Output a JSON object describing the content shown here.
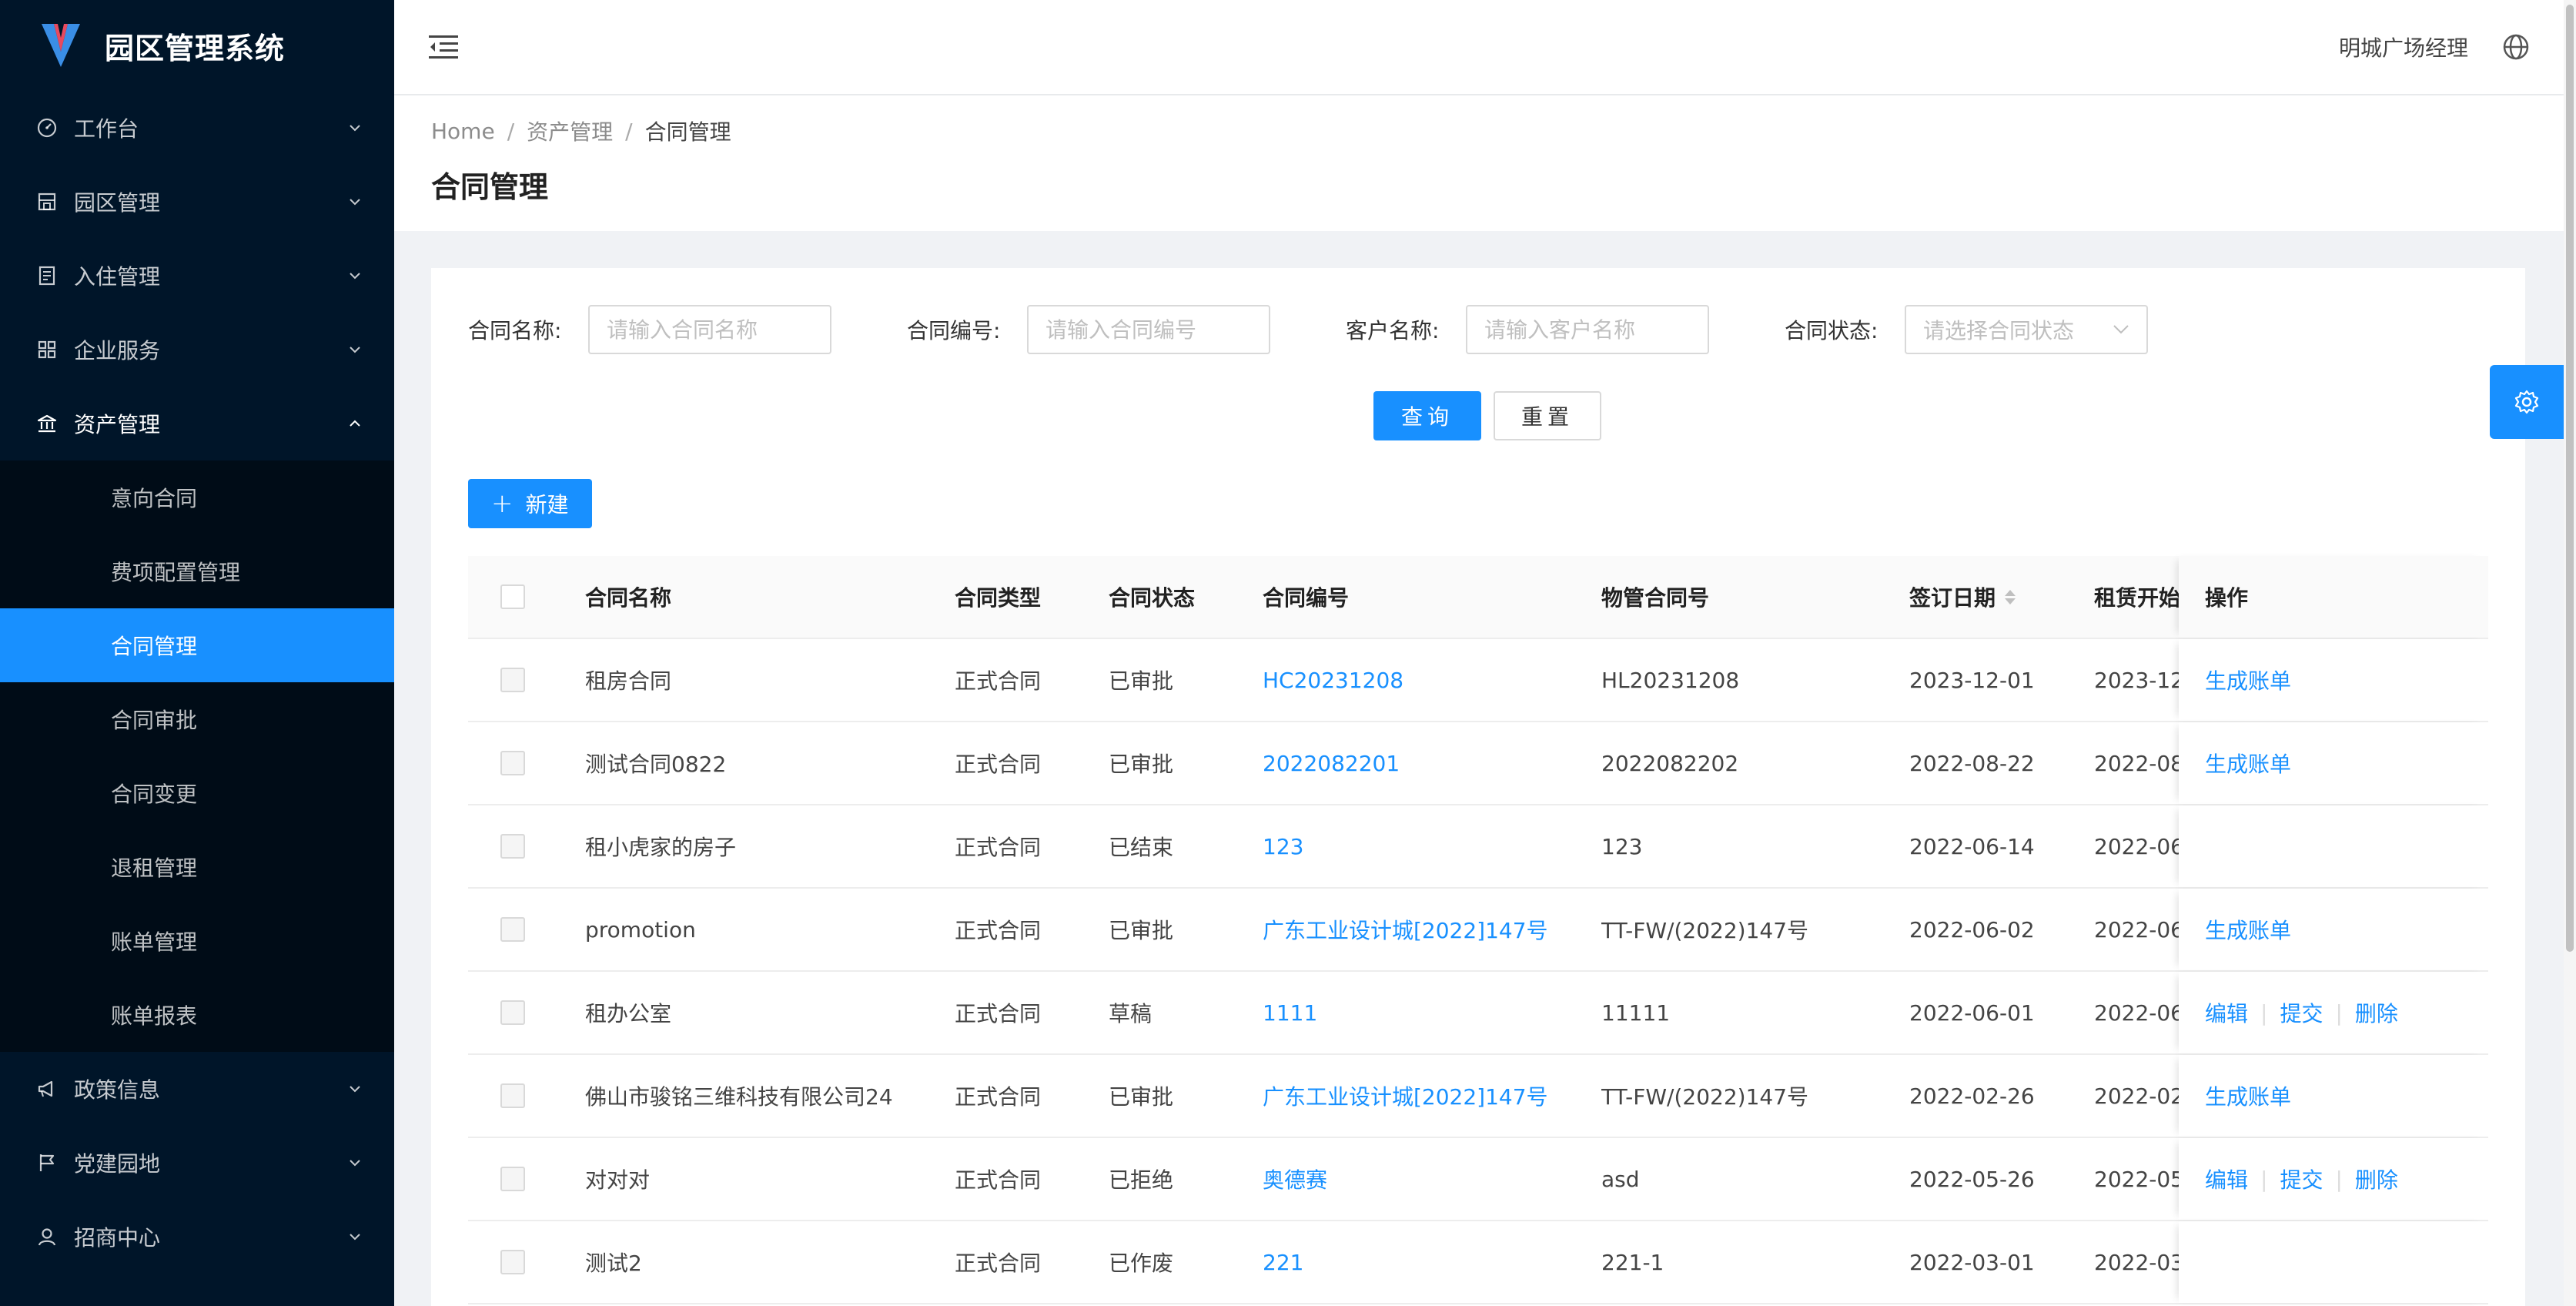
{
  "app": {
    "title": "园区管理系统"
  },
  "sidebar": {
    "items": [
      {
        "label": "工作台",
        "icon": "dashboard-icon"
      },
      {
        "label": "园区管理",
        "icon": "building-icon"
      },
      {
        "label": "入住管理",
        "icon": "document-icon"
      },
      {
        "label": "企业服务",
        "icon": "apps-icon"
      },
      {
        "label": "资产管理",
        "icon": "bank-icon",
        "open": true
      },
      {
        "label": "政策信息",
        "icon": "megaphone-icon"
      },
      {
        "label": "党建园地",
        "icon": "flag-icon"
      },
      {
        "label": "招商中心",
        "icon": "user-icon"
      }
    ],
    "submenu": [
      {
        "label": "意向合同"
      },
      {
        "label": "费项配置管理"
      },
      {
        "label": "合同管理",
        "active": true
      },
      {
        "label": "合同审批"
      },
      {
        "label": "合同变更"
      },
      {
        "label": "退租管理"
      },
      {
        "label": "账单管理"
      },
      {
        "label": "账单报表"
      }
    ]
  },
  "header": {
    "user_name": "明城广场经理"
  },
  "breadcrumb": {
    "home": "Home",
    "level1": "资产管理",
    "current": "合同管理"
  },
  "page": {
    "title": "合同管理"
  },
  "filters": {
    "contract_name": {
      "label": "合同名称:",
      "placeholder": "请输入合同名称"
    },
    "contract_no": {
      "label": "合同编号:",
      "placeholder": "请输入合同编号"
    },
    "customer_name": {
      "label": "客户名称:",
      "placeholder": "请输入客户名称"
    },
    "contract_status": {
      "label": "合同状态:",
      "placeholder": "请选择合同状态"
    }
  },
  "buttons": {
    "query": "查询",
    "reset": "重置",
    "new": "新建"
  },
  "table": {
    "columns": {
      "name": "合同名称",
      "type": "合同类型",
      "status": "合同状态",
      "no": "合同编号",
      "pm_no": "物管合同号",
      "sign_date": "签订日期",
      "start": "租赁开始",
      "action": "操作"
    },
    "rows": [
      {
        "name": "租房合同",
        "type": "正式合同",
        "status": "已审批",
        "no": "HC20231208",
        "pm_no": "HL20231208",
        "sign_date": "2023-12-01",
        "start": "2023-12",
        "actions": [
          "生成账单"
        ]
      },
      {
        "name": "测试合同0822",
        "type": "正式合同",
        "status": "已审批",
        "no": "2022082201",
        "pm_no": "2022082202",
        "sign_date": "2022-08-22",
        "start": "2022-08",
        "actions": [
          "生成账单"
        ]
      },
      {
        "name": "租小虎家的房子",
        "type": "正式合同",
        "status": "已结束",
        "no": "123",
        "pm_no": "123",
        "sign_date": "2022-06-14",
        "start": "2022-06",
        "actions": []
      },
      {
        "name": "promotion",
        "type": "正式合同",
        "status": "已审批",
        "no": "广东工业设计城[2022]147号",
        "pm_no": "TT-FW/(2022)147号",
        "sign_date": "2022-06-02",
        "start": "2022-06",
        "actions": [
          "生成账单"
        ]
      },
      {
        "name": "租办公室",
        "type": "正式合同",
        "status": "草稿",
        "no": "1111",
        "pm_no": "11111",
        "sign_date": "2022-06-01",
        "start": "2022-06",
        "actions": [
          "编辑",
          "提交",
          "删除"
        ]
      },
      {
        "name": "佛山市骏铭三维科技有限公司24",
        "type": "正式合同",
        "status": "已审批",
        "no": "广东工业设计城[2022]147号",
        "pm_no": "TT-FW/(2022)147号",
        "sign_date": "2022-02-26",
        "start": "2022-02",
        "actions": [
          "生成账单"
        ]
      },
      {
        "name": "对对对",
        "type": "正式合同",
        "status": "已拒绝",
        "no": "奥德赛",
        "pm_no": "asd",
        "sign_date": "2022-05-26",
        "start": "2022-05",
        "actions": [
          "编辑",
          "提交",
          "删除"
        ]
      },
      {
        "name": "测试2",
        "type": "正式合同",
        "status": "已作废",
        "no": "221",
        "pm_no": "221-1",
        "sign_date": "2022-03-01",
        "start": "2022-03",
        "actions": []
      }
    ]
  },
  "colors": {
    "sidebar_bg": "#001529",
    "submenu_bg": "#000c17",
    "primary": "#1890ff"
  }
}
